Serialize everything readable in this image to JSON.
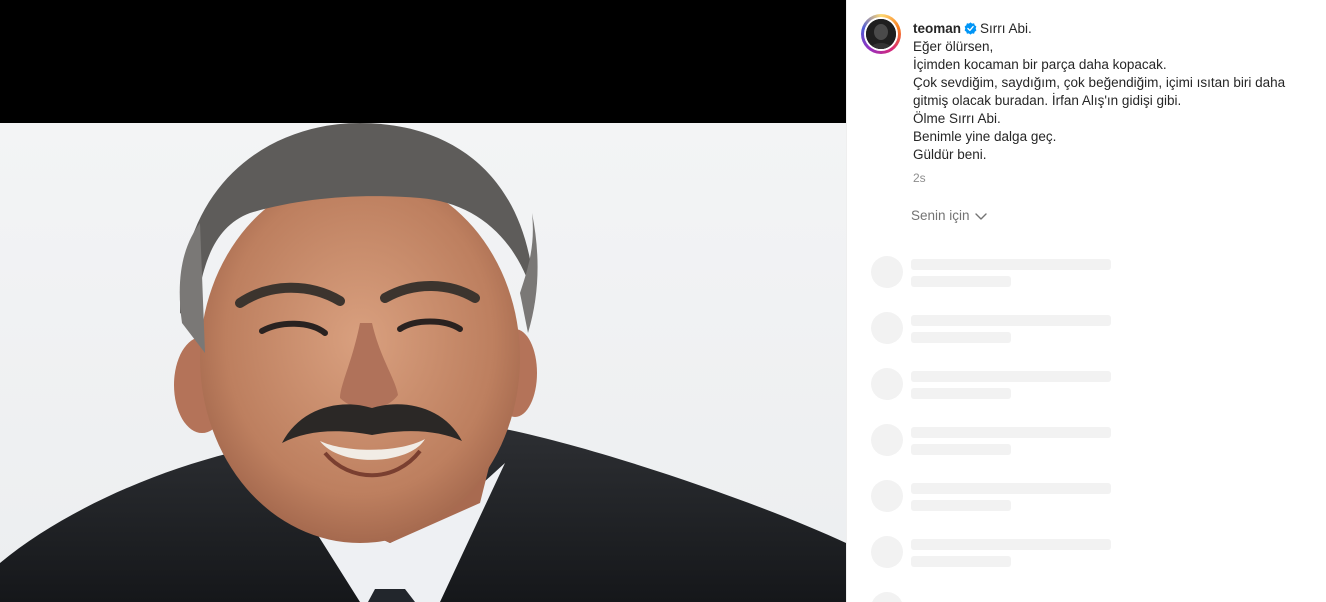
{
  "post": {
    "username": "teoman",
    "verified": true,
    "caption_lines": [
      "Sırrı Abi.",
      "Eğer ölürsen,",
      "İçimden kocaman bir parça daha kopacak.",
      "Çok sevdiğim, saydığım, çok beğendiğim, içimi ısıtan biri daha",
      "gitmiş olacak buradan. İrfan Alış'ın gidişi gibi.",
      "Ölme Sırrı Abi.",
      "Benimle yine dalga geç.",
      "Güldür beni."
    ],
    "time": "2s",
    "for_you_label": "Senin için"
  },
  "colors": {
    "verified_blue": "#0095f6",
    "skeleton": "#f2f2f2",
    "muted_text": "#8e8e8e"
  },
  "icons": {
    "verified": "verified-badge-icon",
    "chevron": "chevron-down-icon"
  }
}
